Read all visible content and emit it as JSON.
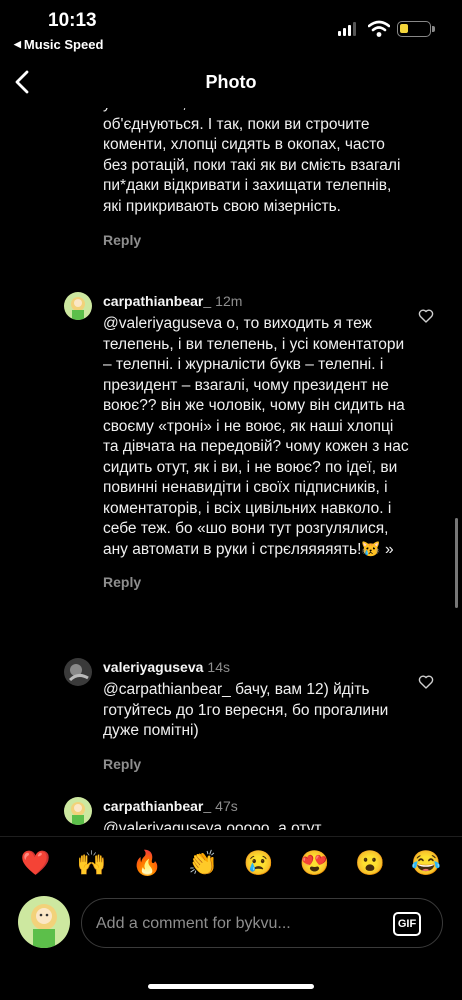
{
  "status": {
    "time": "10:13",
    "back_app": "Music Speed",
    "battery_color": "#f4d63a"
  },
  "header": {
    "title": "Photo"
  },
  "comments": [
    {
      "username": "",
      "time": "",
      "text": "ухилістами, хай вони між собою об'єднуються. І так, поки ви строчите коменти, хлопці сидять в окопах, часто без ротацій, поки такі як ви смієть взагалі пи*даки відкривати і захищати телепнів, які прикривають свою мізерність.",
      "reply": "Reply"
    },
    {
      "username": "carpathianbear_",
      "time": "12m",
      "text": "@valeriyaguseva о, то виходить я теж телепень, і ви телепень, і усі коментатори – телепні. і журналісти букв – телепні. і президент – взагалі, чому президент не воює?? він же чоловік, чому він сидить на своєму «троні» і не воює, як наші хлопці та дівчата на передовій? чому кожен з нас сидить отут, як і ви, і не воює? по ідеї, ви повинні ненавидіти і своїх підписників, і коментаторів, і всіх цивільних навколо. і себе теж. бо «шо вони тут розгулялися, ану автомати в руки і стрєляяяяять!😿 »",
      "reply": "Reply"
    },
    {
      "username": "valeriyaguseva",
      "time": "14s",
      "text": "@carpathianbear_ бачу, вам 12) йдіть готуйтесь до 1го вересня, бо прогалини дуже помітні)",
      "reply": "Reply"
    },
    {
      "username": "carpathianbear_",
      "time": "47s",
      "text": "@valeriyaguseva ооооо, а отут"
    }
  ],
  "emoji_bar": [
    "❤️",
    "🙌",
    "🔥",
    "👏",
    "😢",
    "😍",
    "😮",
    "😂"
  ],
  "composer": {
    "placeholder": "Add a comment for bykvu...",
    "gif_label": "GIF"
  },
  "icons": {
    "back": "chevron-left-icon",
    "like": "heart-outline-icon",
    "gif": "gif-icon"
  }
}
